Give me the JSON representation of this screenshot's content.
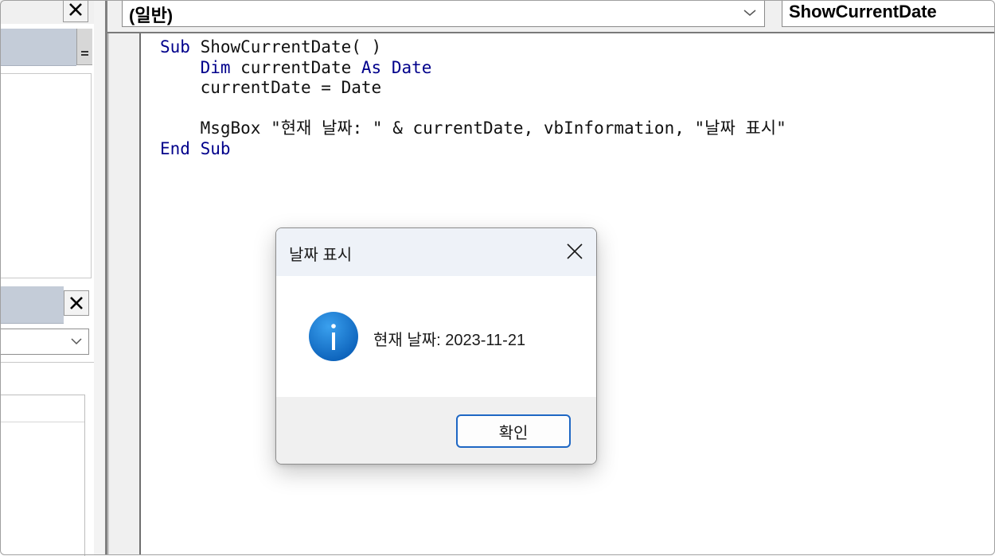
{
  "code_window": {
    "object_combo": "(일반)",
    "procedure_combo": "ShowCurrentDate",
    "code": {
      "line1_kw": "Sub",
      "line1_rest": " ShowCurrentDate( )",
      "line2_kw1": "Dim",
      "line2_mid": " currentDate ",
      "line2_kw2": "As",
      "line2_kw3": "Date",
      "line3": "currentDate = Date",
      "line5": "MsgBox \"현재 날짜: \" & currentDate, vbInformation, \"날짜 표시\"",
      "line6_kw": "End Sub"
    }
  },
  "left_panel": {
    "close_icon": "close-icon"
  },
  "msgbox": {
    "title": "날짜 표시",
    "message": "현재 날짜: 2023-11-21",
    "ok_label": "확인",
    "icon": "information-icon",
    "accent": "#1e67c4"
  }
}
